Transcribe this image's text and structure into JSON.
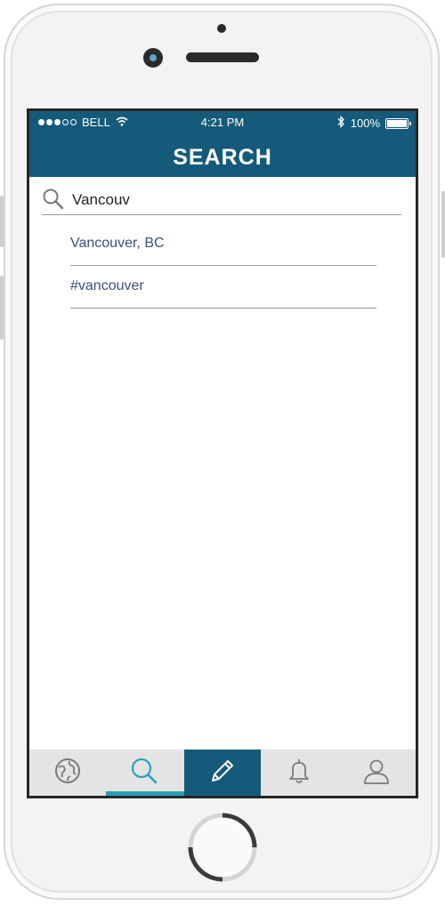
{
  "status_bar": {
    "carrier": "BELL",
    "time": "4:21 PM",
    "battery": "100%"
  },
  "header": {
    "title": "SEARCH"
  },
  "search": {
    "value": "Vancouv"
  },
  "suggestions": [
    {
      "label": "Vancouver, BC"
    },
    {
      "label": "#vancouver"
    }
  ],
  "tabs": [
    {
      "name": "explore",
      "icon": "globe-icon"
    },
    {
      "name": "search",
      "icon": "search-icon",
      "active": true
    },
    {
      "name": "compose",
      "icon": "pencil-icon"
    },
    {
      "name": "notifications",
      "icon": "bell-icon"
    },
    {
      "name": "profile",
      "icon": "user-icon"
    }
  ],
  "colors": {
    "header": "#155a7a",
    "active_tab_indicator": "#2b9fb8",
    "suggestion_text": "#3b4f7a",
    "tab_bar": "#e4e4e4"
  }
}
